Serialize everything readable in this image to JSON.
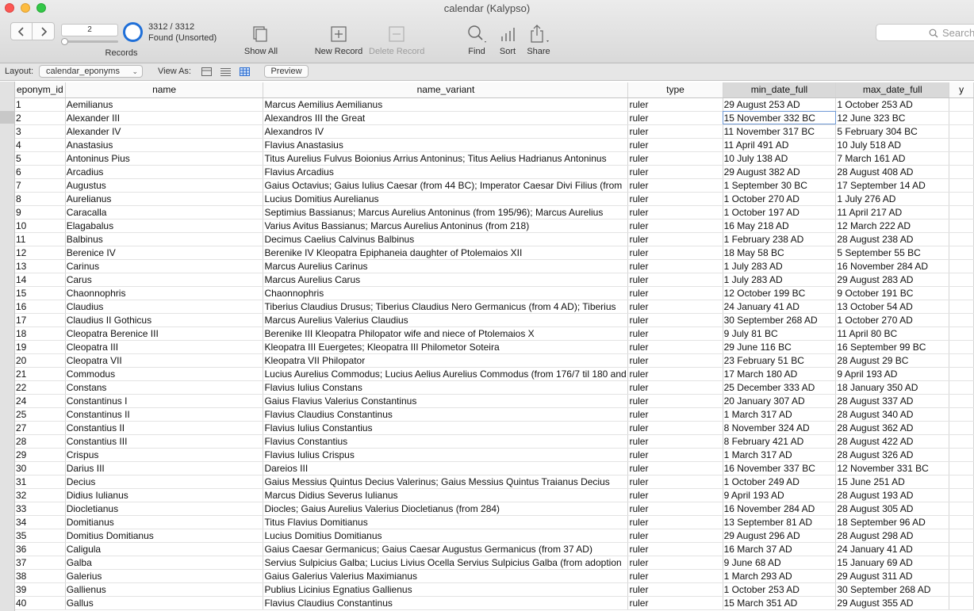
{
  "window": {
    "title": "calendar (Kalypso)"
  },
  "toolbar": {
    "record_field": "2",
    "records_label": "Records",
    "count": "3312 / 3312",
    "found_status": "Found (Unsorted)",
    "show_all": "Show All",
    "new_record": "New Record",
    "delete_record": "Delete Record",
    "find": "Find",
    "sort": "Sort",
    "share": "Share",
    "search_placeholder": "Search"
  },
  "layoutbar": {
    "layout_label": "Layout:",
    "layout_value": "calendar_eponyms",
    "view_as_label": "View As:",
    "preview": "Preview"
  },
  "table": {
    "columns": [
      "eponym_id",
      "name",
      "name_variant",
      "type",
      "min_date_full",
      "max_date_full",
      "y"
    ],
    "rows": [
      [
        "1",
        "Aemilianus",
        "Marcus Aemilius Aemilianus",
        "ruler",
        "29 August 253 AD",
        "1 October 253 AD"
      ],
      [
        "2",
        "Alexander III",
        "Alexandros III the Great",
        "ruler",
        "15 November 332 BC",
        "12 June 323 BC"
      ],
      [
        "3",
        "Alexander IV",
        "Alexandros IV",
        "ruler",
        "11 November 317 BC",
        "5 February 304 BC"
      ],
      [
        "4",
        "Anastasius",
        "Flavius Anastasius",
        "ruler",
        "11 April 491 AD",
        "10 July 518 AD"
      ],
      [
        "5",
        "Antoninus Pius",
        "Titus Aurelius Fulvus Boionius Arrius Antoninus; Titus Aelius Hadrianus Antoninus",
        "ruler",
        "10 July 138 AD",
        "7 March 161 AD"
      ],
      [
        "6",
        "Arcadius",
        "Flavius Arcadius",
        "ruler",
        "29 August 382 AD",
        "28 August 408 AD"
      ],
      [
        "7",
        "Augustus",
        "Gaius Octavius; Gaius Iulius Caesar (from 44 BC); Imperator Caesar Divi Filius (from",
        "ruler",
        "1 September 30 BC",
        "17 September 14 AD"
      ],
      [
        "8",
        "Aurelianus",
        "Lucius Domitius Aurelianus",
        "ruler",
        "1 October 270 AD",
        "1 July 276 AD"
      ],
      [
        "9",
        "Caracalla",
        "Septimius Bassianus; Marcus Aurelius Antoninus (from 195/96); Marcus Aurelius",
        "ruler",
        "1 October 197 AD",
        "11 April 217 AD"
      ],
      [
        "10",
        "Elagabalus",
        "Varius Avitus Bassianus; Marcus Aurelius Antoninus (from 218)",
        "ruler",
        "16 May 218 AD",
        "12 March 222 AD"
      ],
      [
        "11",
        "Balbinus",
        "Decimus Caelius Calvinus Balbinus",
        "ruler",
        "1 February 238 AD",
        "28 August 238 AD"
      ],
      [
        "12",
        "Berenice IV",
        "Berenike IV Kleopatra Epiphaneia daughter of Ptolemaios XII",
        "ruler",
        "18 May 58 BC",
        "5 September 55 BC"
      ],
      [
        "13",
        "Carinus",
        "Marcus Aurelius Carinus",
        "ruler",
        "1 July 283 AD",
        "16 November 284 AD"
      ],
      [
        "14",
        "Carus",
        "Marcus Aurelius Carus",
        "ruler",
        "1 July 283 AD",
        "29 August 283 AD"
      ],
      [
        "15",
        "Chaonnophris",
        "Chaonnophris",
        "ruler",
        "12 October 199 BC",
        "9 October 191 BC"
      ],
      [
        "16",
        "Claudius",
        "Tiberius Claudius Drusus; Tiberius Claudius Nero Germanicus (from 4 AD); Tiberius",
        "ruler",
        "24 January 41 AD",
        "13 October 54 AD"
      ],
      [
        "17",
        "Claudius II Gothicus",
        "Marcus Aurelius Valerius Claudius",
        "ruler",
        "30 September 268 AD",
        "1 October 270 AD"
      ],
      [
        "18",
        "Cleopatra Berenice III",
        "Berenike III Kleopatra Philopator wife and niece of Ptolemaios X",
        "ruler",
        "9 July 81 BC",
        "11 April 80 BC"
      ],
      [
        "19",
        "Cleopatra III",
        "Kleopatra III Euergetes; Kleopatra III Philometor Soteira",
        "ruler",
        "29 June 116 BC",
        "16 September 99 BC"
      ],
      [
        "20",
        "Cleopatra VII",
        "Kleopatra VII Philopator",
        "ruler",
        "23 February 51 BC",
        "28 August 29 BC"
      ],
      [
        "21",
        "Commodus",
        "Lucius Aurelius Commodus; Lucius Aelius Aurelius Commodus (from 176/7 til 180 and",
        "ruler",
        "17 March 180 AD",
        "9 April 193 AD"
      ],
      [
        "22",
        "Constans",
        "Flavius Iulius Constans",
        "ruler",
        "25 December 333 AD",
        "18 January 350 AD"
      ],
      [
        "24",
        "Constantinus I",
        "Gaius Flavius Valerius Constantinus",
        "ruler",
        "20 January 307 AD",
        "28 August 337 AD"
      ],
      [
        "25",
        "Constantinus II",
        "Flavius Claudius Constantinus",
        "ruler",
        "1 March 317 AD",
        "28 August 340 AD"
      ],
      [
        "27",
        "Constantius II",
        "Flavius Iulius Constantius",
        "ruler",
        "8 November 324 AD",
        "28 August 362 AD"
      ],
      [
        "28",
        "Constantius III",
        "Flavius Constantius",
        "ruler",
        "8 February 421 AD",
        "28 August 422 AD"
      ],
      [
        "29",
        "Crispus",
        "Flavius Iulius Crispus",
        "ruler",
        "1 March 317 AD",
        "28 August 326 AD"
      ],
      [
        "30",
        "Darius III",
        "Dareios III",
        "ruler",
        "16 November 337 BC",
        "12 November 331 BC"
      ],
      [
        "31",
        "Decius",
        "Gaius Messius Quintus Decius Valerinus; Gaius Messius Quintus Traianus Decius",
        "ruler",
        "1 October 249 AD",
        "15 June 251 AD"
      ],
      [
        "32",
        "Didius Iulianus",
        "Marcus Didius Severus Iulianus",
        "ruler",
        "9 April 193 AD",
        "28 August 193 AD"
      ],
      [
        "33",
        "Diocletianus",
        "Diocles; Gaius Aurelius Valerius Diocletianus (from 284)",
        "ruler",
        "16 November 284 AD",
        "28 August 305 AD"
      ],
      [
        "34",
        "Domitianus",
        "Titus Flavius Domitianus",
        "ruler",
        "13 September 81 AD",
        "18 September 96 AD"
      ],
      [
        "35",
        "Domitius Domitianus",
        "Lucius Domitius Domitianus",
        "ruler",
        "29 August 296 AD",
        "28 August 298 AD"
      ],
      [
        "36",
        "Caligula",
        "Gaius Caesar Germanicus; Gaius Caesar Augustus Germanicus (from 37 AD)",
        "ruler",
        "16 March 37 AD",
        "24 January 41 AD"
      ],
      [
        "37",
        "Galba",
        "Servius Sulpicius Galba; Lucius Livius Ocella Servius Sulpicius Galba (from adoption",
        "ruler",
        "9 June 68 AD",
        "15 January 69 AD"
      ],
      [
        "38",
        "Galerius",
        "Gaius Galerius Valerius Maximianus",
        "ruler",
        "1 March 293 AD",
        "29 August 311 AD"
      ],
      [
        "39",
        "Gallienus",
        "Publius Licinius Egnatius Gallienus",
        "ruler",
        "1 October 253 AD",
        "30 September 268 AD"
      ],
      [
        "40",
        "Gallus",
        "Flavius Claudius Constantinus",
        "ruler",
        "15 March 351 AD",
        "29 August 355 AD"
      ]
    ]
  }
}
